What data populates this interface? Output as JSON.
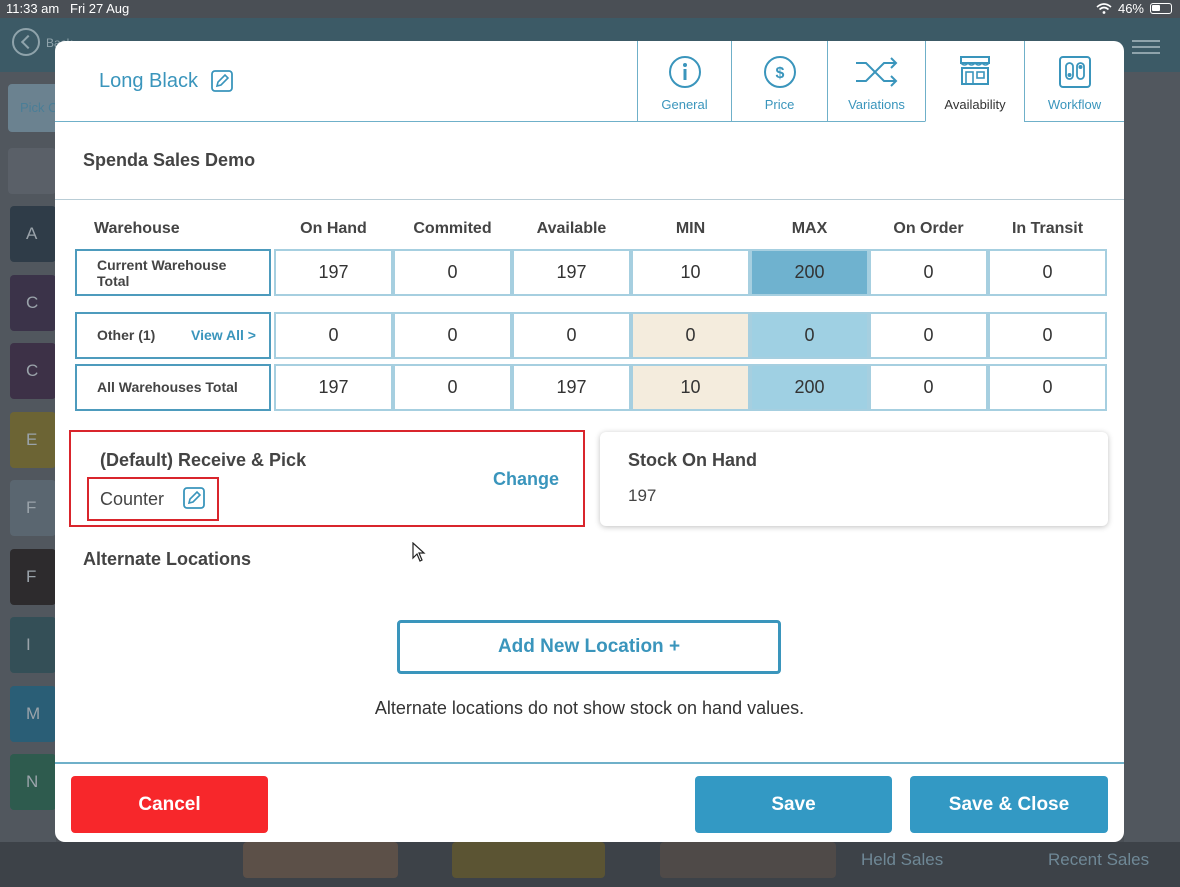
{
  "statusbar": {
    "time": "11:33 am",
    "date": "Fri 27 Aug",
    "battery": "46%"
  },
  "background": {
    "back_label": "Back",
    "pick_label": "Pick Co",
    "tiles": [
      {
        "letter": "A",
        "color": "#2f3c48"
      },
      {
        "letter": "C",
        "color": "#3b3349"
      },
      {
        "letter": "C",
        "color": "#3d3147"
      },
      {
        "letter": "E",
        "color": "#6c6434"
      },
      {
        "letter": "F",
        "color": "#5a6670"
      },
      {
        "letter": "F",
        "color": "#2d2b2d"
      },
      {
        "letter": "I",
        "color": "#344f57"
      },
      {
        "letter": "M",
        "color": "#2a5e76"
      },
      {
        "letter": "N",
        "color": "#2e5b4e"
      }
    ],
    "held_sales": "Held Sales",
    "recent_sales": "Recent Sales"
  },
  "modal": {
    "title": "Long Black",
    "tabs": [
      {
        "label": "General",
        "icon": "info-icon",
        "active": false
      },
      {
        "label": "Price",
        "icon": "dollar-icon",
        "active": false
      },
      {
        "label": "Variations",
        "icon": "shuffle-icon",
        "active": false
      },
      {
        "label": "Availability",
        "icon": "store-icon",
        "active": true
      },
      {
        "label": "Workflow",
        "icon": "workflow-icon",
        "active": false
      }
    ],
    "company": "Spenda Sales Demo",
    "table": {
      "columns": [
        "Warehouse",
        "On Hand",
        "Commited",
        "Available",
        "MIN",
        "MAX",
        "On Order",
        "In Transit"
      ],
      "rows": [
        {
          "label": "Current Warehouse Total",
          "values": [
            "197",
            "0",
            "197",
            "10",
            "200",
            "0",
            "0"
          ]
        },
        {
          "label": "Other (1)",
          "link": "View All >",
          "values": [
            "0",
            "0",
            "0",
            "0",
            "0",
            "0",
            "0"
          ]
        },
        {
          "label": "All Warehouses Total",
          "values": [
            "197",
            "0",
            "197",
            "10",
            "200",
            "0",
            "0"
          ]
        }
      ]
    },
    "receive": {
      "title": "(Default) Receive & Pick",
      "location": "Counter",
      "change_label": "Change"
    },
    "stock_on_hand": {
      "title": "Stock On Hand",
      "value": "197"
    },
    "alternate": {
      "title": "Alternate Locations",
      "add_label": "Add New Location +",
      "note": "Alternate locations do not show stock on hand values."
    },
    "footer": {
      "cancel": "Cancel",
      "save": "Save",
      "save_close": "Save & Close"
    }
  }
}
